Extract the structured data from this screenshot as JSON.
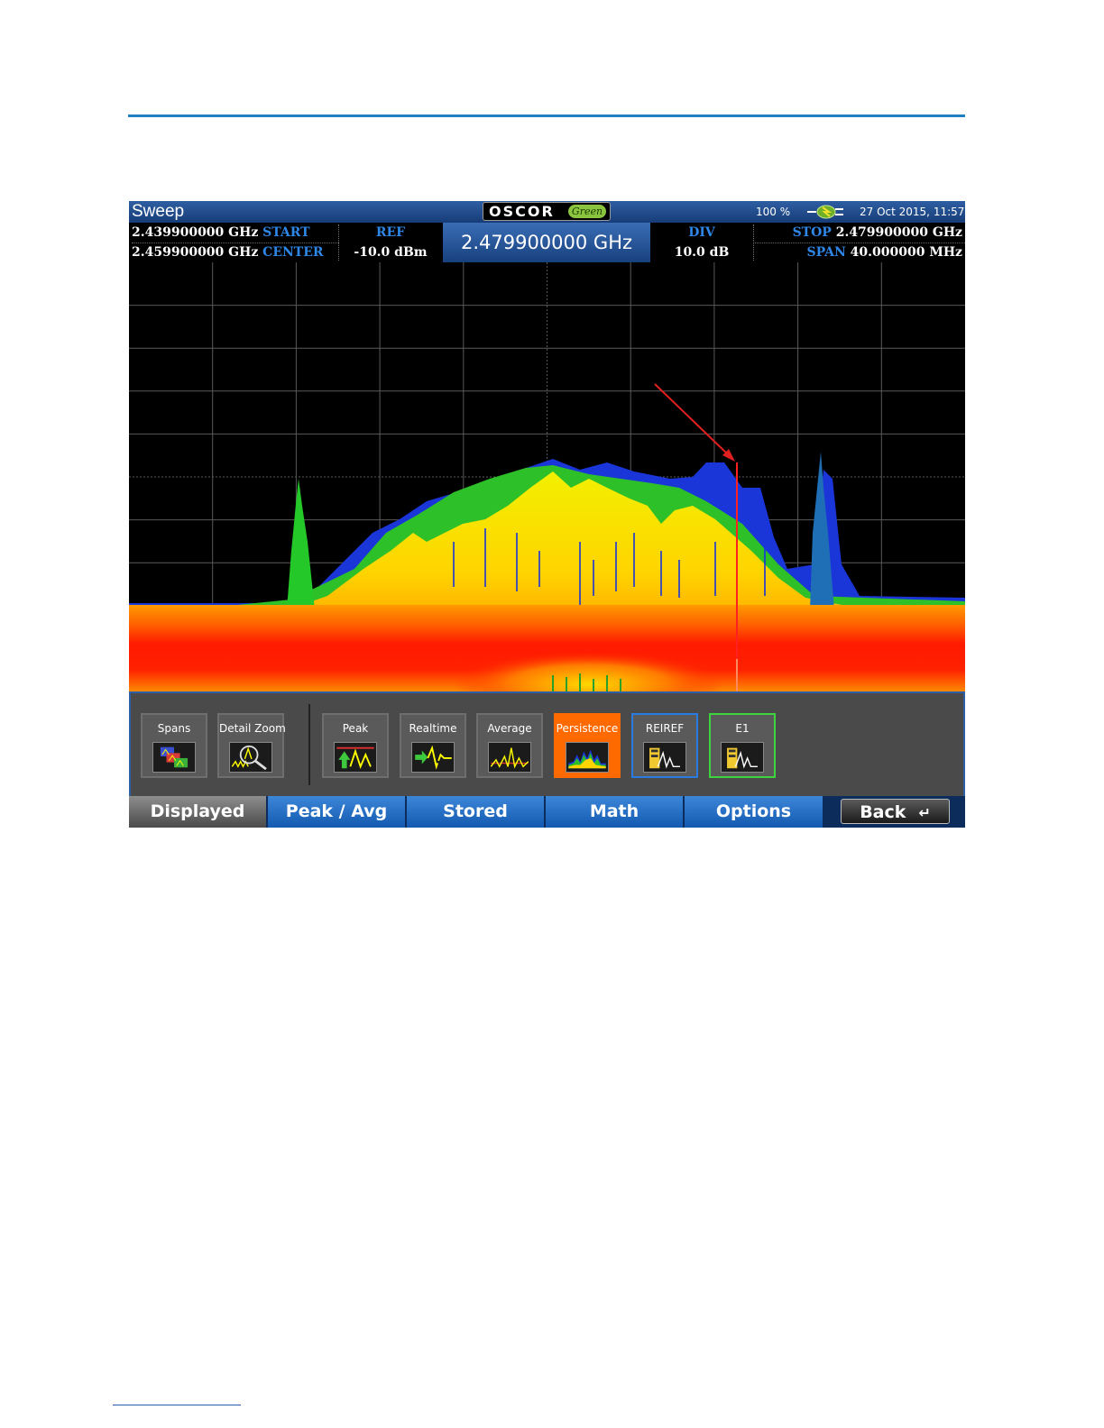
{
  "titlebar": {
    "title": "Sweep",
    "logo_text": "OSCOR",
    "logo_script": "Green",
    "battery": "100 %",
    "datetime": "27 Oct 2015, 11:57"
  },
  "infobar": {
    "start_value": "2.439900000 GHz",
    "start_label": "START",
    "center_value": "2.459900000 GHz",
    "center_label": "CENTER",
    "ref_label": "REF",
    "ref_value": "-10.0 dBm",
    "marker_frequency": "2.479900000 GHz",
    "div_label": "DIV",
    "div_value": "10.0 dB",
    "stop_label": "STOP",
    "stop_value": "2.479900000 GHz",
    "span_label": "SPAN",
    "span_value": "40.000000 MHz"
  },
  "toolbar": {
    "buttons": [
      {
        "label": "Spans",
        "icon": "spans-icon"
      },
      {
        "label": "Detail Zoom",
        "icon": "magnifier-icon"
      },
      {
        "label": "Peak",
        "icon": "peak-trace-icon"
      },
      {
        "label": "Realtime",
        "icon": "realtime-trace-icon"
      },
      {
        "label": "Average",
        "icon": "average-trace-icon"
      },
      {
        "label": "Persistence",
        "icon": "persistence-icon"
      },
      {
        "label": "REIREF",
        "icon": "stored-trace-icon"
      },
      {
        "label": "E1",
        "icon": "stored-trace-icon"
      }
    ]
  },
  "tabs": {
    "displayed": "Displayed",
    "peak_avg": "Peak / Avg",
    "stored": "Stored",
    "math": "Math",
    "options": "Options",
    "back": "Back",
    "back_icon": "↵"
  },
  "colors": {
    "accent_blue": "#2e86e6",
    "active_orange": "#ff6a00",
    "frame_blue": "#2a7be0",
    "frame_green": "#3ed43e",
    "marker_red": "#ff2020"
  }
}
